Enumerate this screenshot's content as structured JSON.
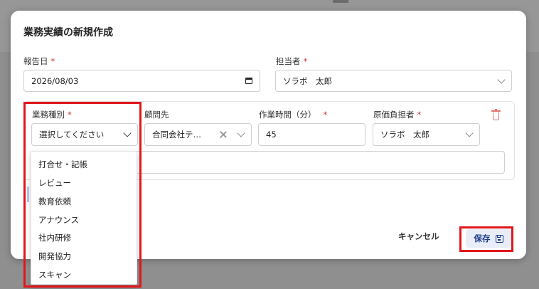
{
  "dialog": {
    "title": "業務実績の新規作成"
  },
  "form": {
    "report_date": {
      "label": "報告日",
      "required": "*",
      "value": "2026/08/03"
    },
    "assignee": {
      "label": "担当者",
      "required": "*",
      "value": "ソラボ　太郎"
    }
  },
  "row": {
    "work_type": {
      "label": "業務種別",
      "required": "*",
      "placeholder": "選択してください"
    },
    "client": {
      "label": "顧問先",
      "value": "合同会社テ…"
    },
    "work_minutes": {
      "label": "作業時間（分）",
      "required": "*",
      "value": "45"
    },
    "cost_owner": {
      "label": "原価負担者",
      "required": "*",
      "value": "ソラボ　太郎"
    },
    "note": {
      "value": ""
    }
  },
  "work_type_options": [
    "打合せ・記帳",
    "レビュー",
    "教育依頼",
    "アナウンス",
    "社内研修",
    "開発協力",
    "スキャン"
  ],
  "actions": {
    "cancel_label": "キャンセル",
    "save_label": "保存"
  },
  "colors": {
    "accent": "#1f3a8a",
    "required": "#d32f2f",
    "highlight": "#e0161b",
    "delete": "#e57373"
  },
  "icons": [
    "calendar-icon",
    "chevron-down-icon",
    "clear-icon",
    "trash-icon",
    "save-icon"
  ]
}
